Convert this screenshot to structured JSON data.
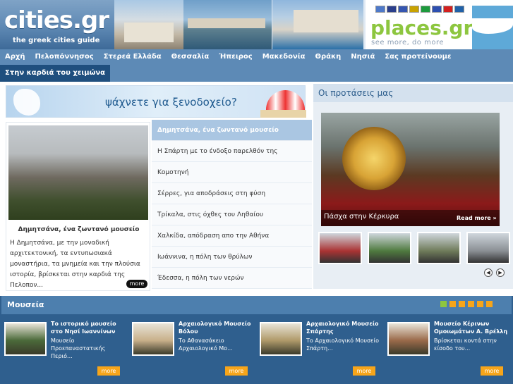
{
  "header": {
    "cities_logo": "cities.gr",
    "cities_tagline": "the greek cities guide",
    "places_logo": "places.gr",
    "places_tagline": "see more, do more",
    "flags": [
      {
        "name": "greek-flag-icon",
        "color": "#4e79c9"
      },
      {
        "name": "uk-flag-icon",
        "color": "#2b3f8c"
      },
      {
        "name": "french-flag-icon",
        "color": "#3556b0"
      },
      {
        "name": "german-flag-icon",
        "color": "#c9a300"
      },
      {
        "name": "italian-flag-icon",
        "color": "#1d9a3d"
      },
      {
        "name": "russian-flag-icon",
        "color": "#2d4fb0"
      },
      {
        "name": "spanish-flag-icon",
        "color": "#d3201f"
      },
      {
        "name": "swedish-flag-icon",
        "color": "#2061a8"
      }
    ]
  },
  "nav": {
    "items": [
      "Αρχή",
      "Πελοπόννησος",
      "Στερεά Ελλάδα",
      "Θεσσαλία",
      "Ήπειρος",
      "Μακεδονία",
      "Θράκη",
      "Νησιά",
      "Σας προτείνουμε"
    ],
    "second_row": [
      "Στην καρδιά του χειμώνα"
    ]
  },
  "hotel_banner": {
    "text": "ψάχνετε για ξενοδοχείο?"
  },
  "featured": {
    "caption": "Δημητσάνα, ένα ζωντανό μουσείο",
    "description": "Η Δημητσάνα, με την μοναδική αρχιτεκτονική, τα εντυπωσιακά μοναστήρια, τα μνημεία και την πλούσια ιστορία, βρίσκεται στην καρδιά της Πελοπον...",
    "more_label": "more"
  },
  "articles": [
    "Δημητσάνα, ένα ζωντανό μουσείο",
    "Η Σπάρτη με το ένδοξο παρελθόν της",
    "Κομοτηνή",
    "Σέρρες, για αποδράσεις στη φύση",
    "Τρίκαλα, στις όχθες του Ληθαίου",
    "Χαλκίδα, απόδραση απο την Αθήνα",
    "Ιωάννινα, η πόλη των θρύλων",
    "Έδεσσα, η πόλη των νερών"
  ],
  "proposals": {
    "title": "Οι προτάσεις μας",
    "caption": "Πάσχα στην Κέρκυρα",
    "read_more": "Read more »",
    "thumbs": [
      {
        "color": "#a33"
      },
      {
        "color": "#4f7a3f"
      },
      {
        "color": "#6f7b5a"
      },
      {
        "color": "#8a8f94"
      }
    ],
    "prev": "◀",
    "next": "▶"
  },
  "museums": {
    "title": "Μουσεία",
    "pager_count": 6,
    "cards": [
      {
        "title": "Το ιστορικό μουσείο στο Νησί Ιωαννίνων",
        "desc": "Μουσείο Προεπαναστατικής Περιό...",
        "more": "more",
        "color": "#4b6a3a"
      },
      {
        "title": "Αρχαιολογικό Μουσείο Βόλου",
        "desc": "Το Αθανασάκειο Αρχαιολογικό Μο...",
        "more": "more",
        "color": "#c8b08a"
      },
      {
        "title": "Αρχαιολογικό Μουσείο Σπάρτης",
        "desc": "Το Αρχαιολογικό Μουσείο Σπάρτη...",
        "more": "more",
        "color": "#b09a6a"
      },
      {
        "title": "Μουσείο Κέρινων Ομοιωμάτων Α. Βρέλλη",
        "desc": "Βρίσκεται κοντά στην είσοδο του...",
        "more": "more",
        "color": "#9a6a4a"
      }
    ]
  }
}
